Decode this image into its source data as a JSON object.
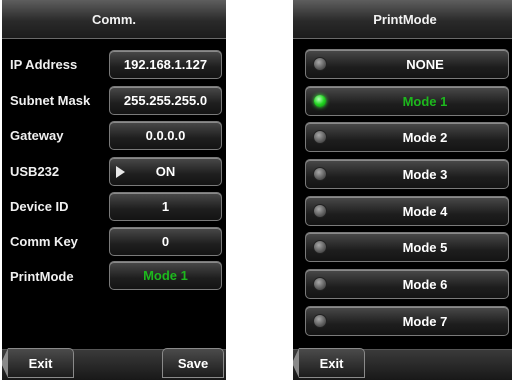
{
  "left": {
    "title": "Comm.",
    "rows": [
      {
        "label": "IP Address",
        "value": "192.168.1.127"
      },
      {
        "label": "Subnet Mask",
        "value": "255.255.255.0"
      },
      {
        "label": "Gateway",
        "value": "0.0.0.0"
      },
      {
        "label": "USB232",
        "value": "ON"
      },
      {
        "label": "Device ID",
        "value": "1"
      },
      {
        "label": "Comm Key",
        "value": "0"
      },
      {
        "label": "PrintMode",
        "value": "Mode 1"
      }
    ],
    "exit_label": "Exit",
    "save_label": "Save"
  },
  "right": {
    "title": "PrintMode",
    "options": [
      "NONE",
      "Mode 1",
      "Mode 2",
      "Mode 3",
      "Mode 4",
      "Mode 5",
      "Mode 6",
      "Mode 7"
    ],
    "selected": "Mode 1",
    "exit_label": "Exit"
  },
  "colors": {
    "selected_text": "#1db81d",
    "led_on": "#22d622",
    "led_off": "#5a5a5a",
    "background": "#000000"
  }
}
